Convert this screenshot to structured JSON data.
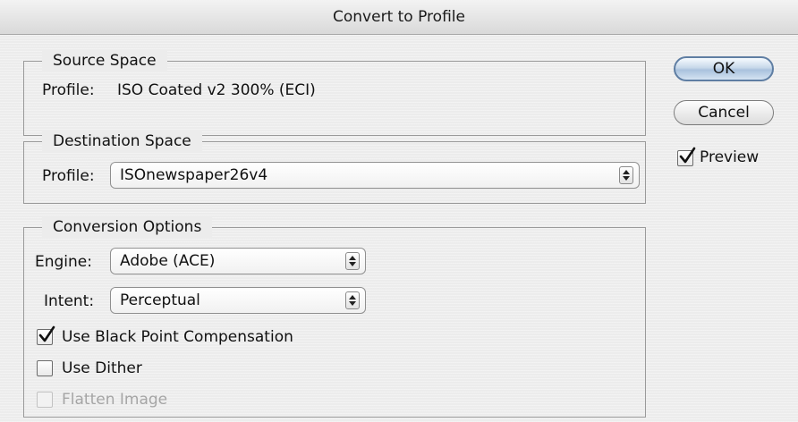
{
  "dialog": {
    "title": "Convert to Profile"
  },
  "source": {
    "legend": "Source Space",
    "profile_label": "Profile:",
    "profile_value": "ISO Coated v2 300% (ECI)"
  },
  "destination": {
    "legend": "Destination Space",
    "profile_label": "Profile:",
    "profile_value": "ISOnewspaper26v4"
  },
  "conversion": {
    "legend": "Conversion Options",
    "engine_label": "Engine:",
    "engine_value": "Adobe (ACE)",
    "intent_label": "Intent:",
    "intent_value": "Perceptual",
    "black_point": {
      "label": "Use Black Point Compensation",
      "checked": true
    },
    "dither": {
      "label": "Use Dither",
      "checked": false
    },
    "flatten": {
      "label": "Flatten Image",
      "checked": false,
      "enabled": false
    }
  },
  "buttons": {
    "ok_label": "OK",
    "cancel_label": "Cancel"
  },
  "preview": {
    "label": "Preview",
    "checked": true
  },
  "icons": {
    "checkmark": "checkmark-icon",
    "stepper": "up-down-arrows-icon"
  },
  "colors": {
    "default_button": "#a9c2dd",
    "disabled_text": "#a5a5a5"
  }
}
